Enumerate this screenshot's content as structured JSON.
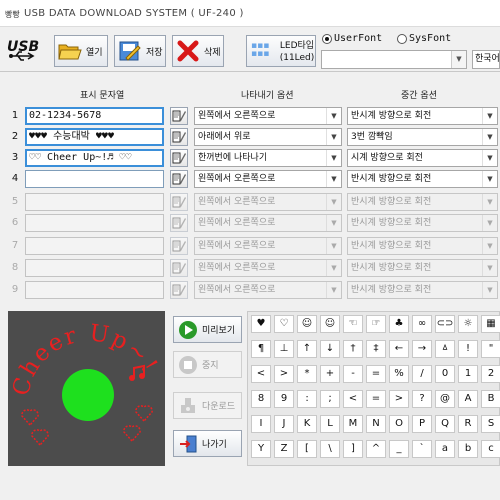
{
  "window": {
    "title_icon": "빵빵",
    "title": "USB DATA DOWNLOAD SYSTEM  ( UF-240 )"
  },
  "toolbar": {
    "logo": "USB",
    "open_label": "열기",
    "save_label": "저장",
    "delete_label": "삭제",
    "led_label_line1": "LED타입",
    "led_label_line2": "(11Led)",
    "font_options": [
      {
        "label": "UserFont",
        "checked": true
      },
      {
        "label": "SysFont",
        "checked": false
      }
    ],
    "font_select_value": "",
    "lang_value": "한국어"
  },
  "columns": {
    "display_text": "표시 문자열",
    "appear_option": "나타내기 옵션",
    "middle_option": "중간 옵션"
  },
  "rows": [
    {
      "num": "1",
      "text": "02-1234-5678",
      "appear": "왼쪽에서 오른쪽으로",
      "middle": "반시계 방향으로 회전",
      "enabled": true,
      "highlight": true
    },
    {
      "num": "2",
      "text": "♥♥♥ 수능대박 ♥♥♥",
      "appear": "아래에서 위로",
      "middle": "3번 깜빡임",
      "enabled": true,
      "highlight": true
    },
    {
      "num": "3",
      "text": "♡♡ Cheer Up~!♬ ♡♡",
      "appear": "한꺼번에 나타나기",
      "middle": "시계 방향으로 회전",
      "enabled": true,
      "highlight": true
    },
    {
      "num": "4",
      "text": "",
      "appear": "왼쪽에서 오른쪽으로",
      "middle": "반시계 방향으로 회전",
      "enabled": true,
      "highlight": false
    },
    {
      "num": "5",
      "text": "",
      "appear": "왼쪽에서 오른쪽으로",
      "middle": "반시계 방향으로 회전",
      "enabled": false,
      "highlight": false
    },
    {
      "num": "6",
      "text": "",
      "appear": "왼쪽에서 오른쪽으로",
      "middle": "반시계 방향으로 회전",
      "enabled": false,
      "highlight": false
    },
    {
      "num": "7",
      "text": "",
      "appear": "왼쪽에서 오른쪽으로",
      "middle": "반시계 방향으로 회전",
      "enabled": false,
      "highlight": false
    },
    {
      "num": "8",
      "text": "",
      "appear": "왼쪽에서 오른쪽으로",
      "middle": "반시계 방향으로 회전",
      "enabled": false,
      "highlight": false
    },
    {
      "num": "9",
      "text": "",
      "appear": "왼쪽에서 오른쪽으로",
      "middle": "반시계 방향으로 회전",
      "enabled": false,
      "highlight": false
    }
  ],
  "preview": {
    "text": "Cheer Up~!",
    "text_color": "#e82020",
    "circle_color": "#1ee01e",
    "bg_color": "#4c4c4c"
  },
  "side_buttons": {
    "preview": "미리보기",
    "stop": "중지",
    "download": "다운로드",
    "exit": "나가기"
  },
  "glyph_rows": [
    [
      "♥",
      "♡",
      "☺",
      "☺",
      "☜",
      "☞",
      "♣",
      "∞",
      "⊂⊃",
      "☼",
      "▦"
    ],
    [
      "¶",
      "⊥",
      "↑",
      "↓",
      "†",
      "‡",
      "←",
      "→",
      "ㅿ",
      "!",
      "\""
    ],
    [
      "<",
      ">",
      "*",
      "+",
      "-",
      "=",
      "%",
      "/",
      "0",
      "1",
      "2"
    ],
    [
      "8",
      "9",
      ":",
      ";",
      "<",
      "=",
      ">",
      "?",
      "@",
      "A",
      "B"
    ],
    [
      "I",
      "J",
      "K",
      "L",
      "M",
      "N",
      "O",
      "P",
      "Q",
      "R",
      "S"
    ],
    [
      "Y",
      "Z",
      "[",
      "\\",
      "]",
      "^",
      "_",
      "`",
      "a",
      "b",
      "c"
    ]
  ]
}
